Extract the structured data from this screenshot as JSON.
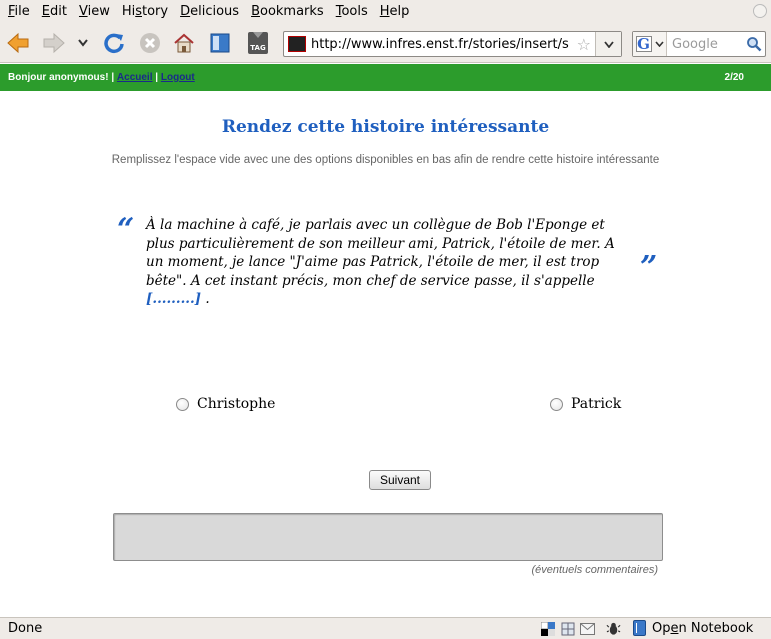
{
  "menu": {
    "items": [
      {
        "label": "File",
        "accel": "F",
        "rest": "ile"
      },
      {
        "label": "Edit",
        "accel": "E",
        "rest": "dit"
      },
      {
        "label": "View",
        "accel": "V",
        "rest": "iew"
      },
      {
        "label": "History",
        "pre": "Hi",
        "accel": "s",
        "rest": "tory"
      },
      {
        "label": "Delicious",
        "pre": "",
        "accel": "D",
        "rest": "elicious"
      },
      {
        "label": "Bookmarks",
        "accel": "B",
        "rest": "ookmarks"
      },
      {
        "label": "Tools",
        "accel": "T",
        "rest": "ools"
      },
      {
        "label": "Help",
        "accel": "H",
        "rest": "elp"
      }
    ]
  },
  "toolbar": {
    "url": "http://www.infres.enst.fr/stories/insert/show",
    "search_placeholder": "Google",
    "tag_label": "TAG"
  },
  "header": {
    "greeting": "Bonjour anonymous! |",
    "home_link": "Accueil",
    "separator": "|",
    "logout_link": "Logout",
    "progress": "2/20"
  },
  "main": {
    "title": "Rendez cette histoire intéressante",
    "subtitle": "Remplissez l'espace vide avec une des options disponibles en bas afin de rendre cette histoire intéressante",
    "quote_open": "“",
    "quote_close": "”",
    "story_text": "À la machine à café, je parlais avec un collègue de Bob l'Eponge et plus particulièrement de son meilleur ami, Patrick, l'étoile de mer. A un moment, je lance \"J'aime pas Patrick, l'étoile de mer, il est trop bête\". A cet instant précis, mon chef de service passe, il s'appelle ",
    "blank": "[.........]",
    "story_end": " .",
    "options": [
      {
        "label": "Christophe"
      },
      {
        "label": "Patrick"
      }
    ],
    "next_button": "Suivant",
    "comment_hint": "(éventuels commentaires)"
  },
  "status": {
    "text": "Done",
    "notebook_label": "Open Notebook",
    "notebook_pre": "Op",
    "notebook_accel": "e",
    "notebook_rest": "n Notebook"
  },
  "colors": {
    "header_green": "#2c9c2c",
    "title_blue": "#1f5fbf",
    "chrome_bg": "#efebe7"
  }
}
